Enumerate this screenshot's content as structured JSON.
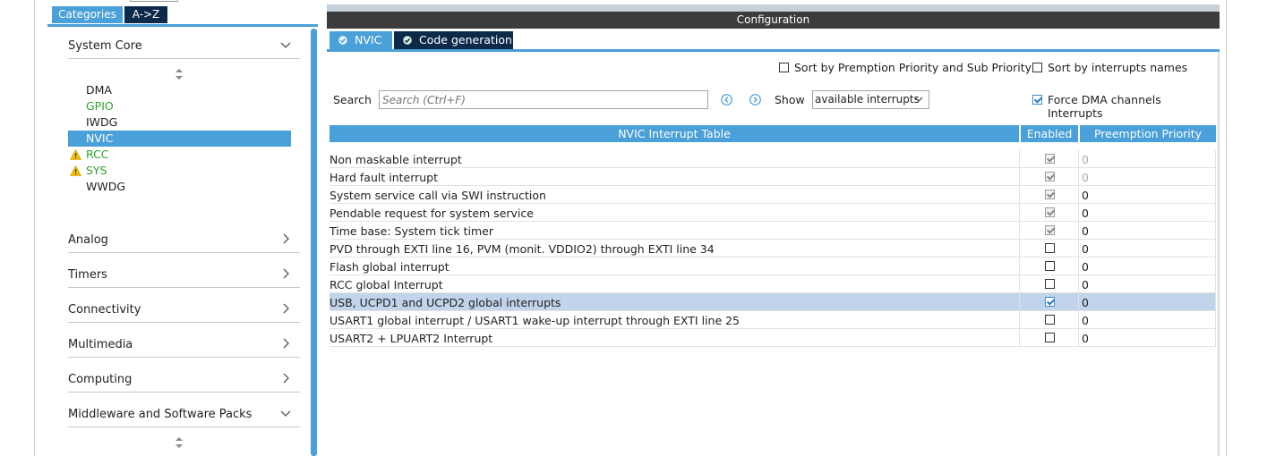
{
  "left": {
    "tabs": {
      "categories": "Categories",
      "az": "A->Z"
    },
    "categories": {
      "system_core": "System Core",
      "analog": "Analog",
      "timers": "Timers",
      "connectivity": "Connectivity",
      "multimedia": "Multimedia",
      "computing": "Computing",
      "middleware": "Middleware and Software Packs"
    },
    "system_core_items": [
      {
        "label": "DMA",
        "state": "normal"
      },
      {
        "label": "GPIO",
        "state": "green"
      },
      {
        "label": "IWDG",
        "state": "normal"
      },
      {
        "label": "NVIC",
        "state": "selected"
      },
      {
        "label": "RCC",
        "state": "warning"
      },
      {
        "label": "SYS",
        "state": "warning"
      },
      {
        "label": "WWDG",
        "state": "normal"
      }
    ]
  },
  "config": {
    "title": "Configuration",
    "tabs": {
      "nvic": "NVIC",
      "code_generation": "Code generation"
    },
    "options": {
      "sort_by_priority": {
        "label": "Sort by Premption Priority and Sub Priority",
        "checked": false
      },
      "sort_by_names": {
        "label": "Sort by interrupts names",
        "checked": false
      },
      "force_dma": {
        "label": "Force DMA channels Interrupts",
        "checked": true
      }
    },
    "search": {
      "label": "Search",
      "placeholder": "Search (Ctrl+F)"
    },
    "show": {
      "label": "Show",
      "value": "available interrupts"
    }
  },
  "table": {
    "headers": {
      "name": "NVIC Interrupt Table",
      "enabled": "Enabled",
      "priority": "Preemption Priority"
    },
    "rows": [
      {
        "name": "Non maskable interrupt",
        "enabled": "locked",
        "priority": "0",
        "muted": true
      },
      {
        "name": "Hard fault interrupt",
        "enabled": "locked",
        "priority": "0",
        "muted": true
      },
      {
        "name": "System service call via SWI instruction",
        "enabled": "locked",
        "priority": "0",
        "muted": false
      },
      {
        "name": "Pendable request for system service",
        "enabled": "locked",
        "priority": "0",
        "muted": false
      },
      {
        "name": "Time base: System tick timer",
        "enabled": "locked",
        "priority": "0",
        "muted": false
      },
      {
        "name": "PVD through EXTI line 16, PVM (monit. VDDIO2) through EXTI line 34",
        "enabled": "off",
        "priority": "0",
        "muted": false
      },
      {
        "name": "Flash global interrupt",
        "enabled": "off",
        "priority": "0",
        "muted": false
      },
      {
        "name": "RCC global Interrupt",
        "enabled": "off",
        "priority": "0",
        "muted": false
      },
      {
        "name": "USB, UCPD1 and UCPD2 global interrupts",
        "enabled": "on",
        "priority": "0",
        "muted": false,
        "selected": true
      },
      {
        "name": "USART1 global interrupt / USART1 wake-up interrupt through EXTI line 25",
        "enabled": "off",
        "priority": "0",
        "muted": false
      },
      {
        "name": "USART2 + LPUART2 Interrupt",
        "enabled": "off",
        "priority": "0",
        "muted": false
      }
    ]
  },
  "colors": {
    "accent": "#4aa0d8",
    "dark_tab": "#0d2a4a",
    "title_bar": "#3c3c3c",
    "selected_row": "#c1d4eb",
    "green_text": "#2fa12f",
    "warning": "#f0c000"
  }
}
